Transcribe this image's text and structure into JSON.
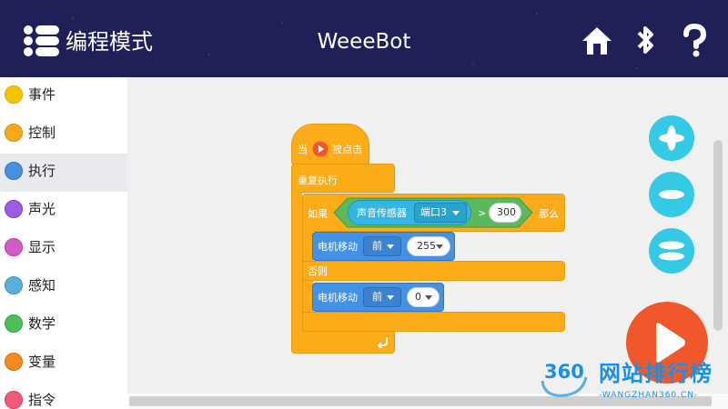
{
  "header": {
    "mode_label": "编程模式",
    "title": "WeeeBot",
    "menu_icon": "menu-list-icon",
    "home_icon": "home-icon",
    "bluetooth_icon": "bluetooth-icon",
    "help_icon": "help-icon"
  },
  "sidebar": {
    "items": [
      {
        "label": "事件",
        "color": "#f5c400"
      },
      {
        "label": "控制",
        "color": "#f7a81b"
      },
      {
        "label": "执行",
        "color": "#4b8fe0"
      },
      {
        "label": "声光",
        "color": "#9b5de5"
      },
      {
        "label": "显示",
        "color": "#d35ac7"
      },
      {
        "label": "感知",
        "color": "#5ab0d8"
      },
      {
        "label": "数学",
        "color": "#4fbf5a"
      },
      {
        "label": "变量",
        "color": "#f58a1f"
      },
      {
        "label": "指令",
        "color": "#f05a78"
      }
    ],
    "active_index": 2
  },
  "blocks": {
    "hat": {
      "prefix": "当",
      "suffix": "被点击",
      "icon": "play-icon"
    },
    "forever": {
      "label": "重复执行",
      "loop_icon": "loop-arrow-icon"
    },
    "if_else": {
      "if_label": "如果",
      "then_label": "那么",
      "else_label": "否则"
    },
    "condition": {
      "operator": ">",
      "value": "300"
    },
    "sensor": {
      "label": "声音传感器",
      "port": "端口3"
    },
    "motor1": {
      "label": "电机移动",
      "direction": "前",
      "speed": "255"
    },
    "motor2": {
      "label": "电机移动",
      "direction": "前",
      "speed": "0"
    }
  },
  "controls": {
    "zoom_in_icon": "zoom-in-icon",
    "zoom_out_icon": "zoom-out-icon",
    "reset_icon": "reset-view-icon",
    "run_icon": "run-play-icon"
  },
  "watermark": {
    "number": "360",
    "text": "网站排行榜",
    "url": "-WANGZHAN360.CN-"
  },
  "colors": {
    "header_bg": "#1f2058",
    "control_block": "#fcac18",
    "action_block": "#4591e3",
    "operator_block": "#5cb85c",
    "sensor_block": "#35b6e0",
    "fab": "#35c9e6",
    "run": "#f0572b"
  }
}
